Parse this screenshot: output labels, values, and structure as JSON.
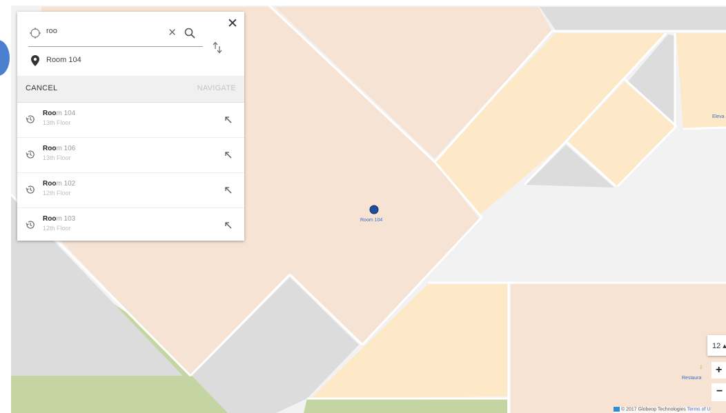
{
  "colors": {
    "room": "#f6e3d3",
    "room_yellow": "#fde9c8",
    "corridor": "#f3f3f3",
    "service": "#dcdcdc",
    "green": "#c4d5a3",
    "accent": "#1f4e9b"
  },
  "search": {
    "origin_value": "roo",
    "destination_value": "Room 104",
    "cancel_label": "CANCEL",
    "navigate_label": "NAVIGATE",
    "results": [
      {
        "match": "Roo",
        "rest": "m 104",
        "floor": "13th Floor"
      },
      {
        "match": "Roo",
        "rest": "m 106",
        "floor": "13th Floor"
      },
      {
        "match": "Roo",
        "rest": "m 102",
        "floor": "12th Floor"
      },
      {
        "match": "Roo",
        "rest": "m 103",
        "floor": "12th Floor"
      }
    ]
  },
  "map": {
    "marker_label": "Room 104",
    "elevator_label": "Eleva",
    "restaurant_label": "Restaura",
    "restaurant_icon": "‡",
    "floor_selector": "12 ▴",
    "zoom_in": "+",
    "zoom_out": "−",
    "attribution": "© 2017 Globeop Technologies",
    "terms": "Terms of U"
  }
}
